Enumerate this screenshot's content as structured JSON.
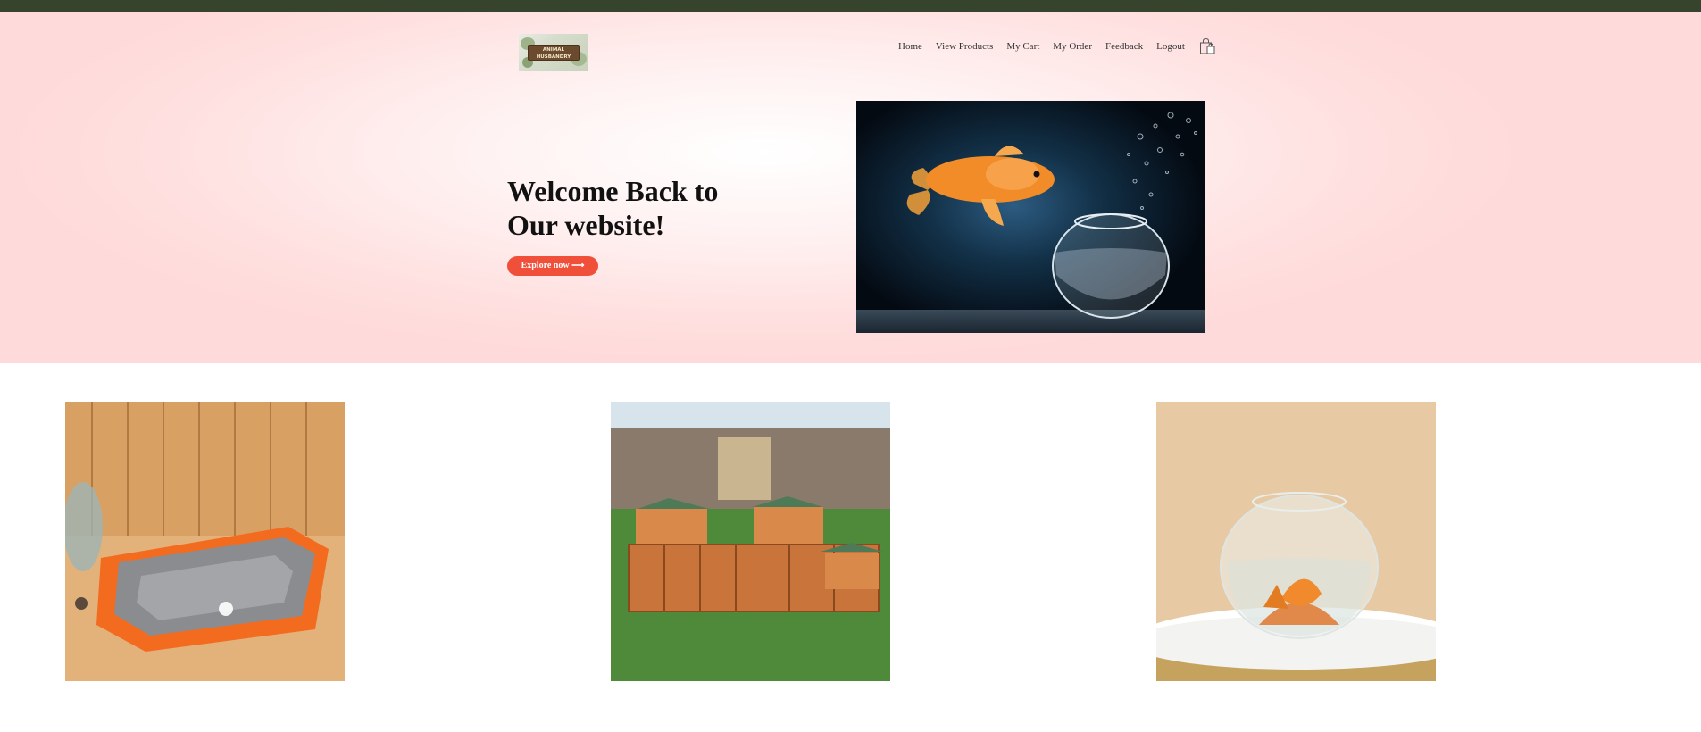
{
  "brand": {
    "logo_icon": "animal-husbandry-logo",
    "logo_text_line1": "ANIMAL",
    "logo_text_line2": "HUSBANDRY"
  },
  "nav": {
    "items": [
      {
        "label": "Home"
      },
      {
        "label": "View Products"
      },
      {
        "label": "My Cart"
      },
      {
        "label": "My Order"
      },
      {
        "label": "Feedback"
      },
      {
        "label": "Logout"
      }
    ],
    "cart_icon": "shopping-bag-icon"
  },
  "hero": {
    "title_line1": "Welcome Back to",
    "title_line2": "Our website!",
    "cta_label": "Explore now ⟶",
    "image": "goldfish-jumping-into-bowl"
  },
  "products": [
    {
      "image": "orange-pet-bed"
    },
    {
      "image": "wooden-chicken-coop"
    },
    {
      "image": "glass-fish-bowl"
    }
  ],
  "colors": {
    "top_strip": "#36432d",
    "hero_background": "#ffdada",
    "accent": "#f0503a"
  }
}
